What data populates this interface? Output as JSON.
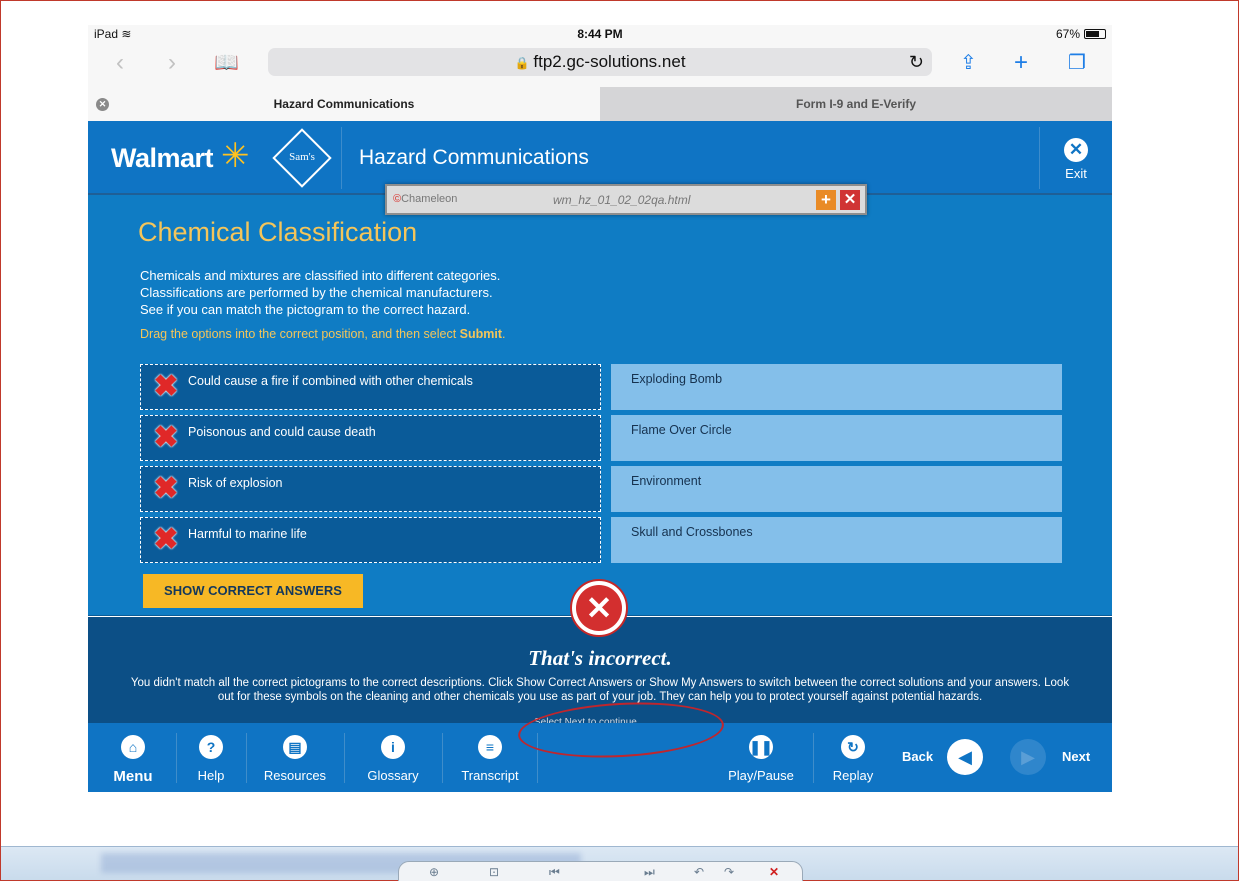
{
  "status_bar": {
    "device": "iPad",
    "time": "8:44 PM",
    "battery": "67%"
  },
  "browser": {
    "url": "ftp2.gc-solutions.net",
    "tabs": [
      {
        "label": "Hazard Communications",
        "active": true
      },
      {
        "label": "Form I-9 and E-Verify",
        "active": false
      }
    ]
  },
  "course_header": {
    "brand": "Walmart",
    "partner_logo": "Sam's CLUB",
    "title": "Hazard Communications",
    "exit_label": "Exit"
  },
  "overlay": {
    "logo": "Chameleon",
    "filename": "wm_hz_01_02_02qa.html"
  },
  "content": {
    "heading": "Chemical Classification",
    "intro_lines": [
      "Chemicals and mixtures are classified into different categories.",
      "Classifications are performed by the chemical manufacturers.",
      "See if you can match the pictogram to the correct hazard."
    ],
    "instruction_pre": "Drag the options into the correct position, and then select ",
    "instruction_bold": "Submit",
    "instruction_post": ".",
    "drag_items": [
      {
        "label": "Could cause a fire if combined with other chemicals",
        "status": "incorrect"
      },
      {
        "label": "Poisonous and could cause death",
        "status": "incorrect"
      },
      {
        "label": "Risk of explosion",
        "status": "incorrect"
      },
      {
        "label": "Harmful to marine life",
        "status": "incorrect"
      }
    ],
    "targets": [
      {
        "label": "Exploding Bomb"
      },
      {
        "label": "Flame Over Circle"
      },
      {
        "label": "Environment"
      },
      {
        "label": "Skull and Crossbones"
      }
    ],
    "show_answers_label": "SHOW CORRECT ANSWERS"
  },
  "feedback": {
    "title": "That's incorrect.",
    "text": "You didn't match all the correct pictograms to the correct descriptions. Click Show Correct Answers or Show My Answers to switch between the correct solutions and your answers. Look out for these symbols on the cleaning and other chemicals you use as part of your job. They can help you to protect yourself against potential hazards.",
    "hint": "Select Next to continue."
  },
  "nav": {
    "menu": "Menu",
    "help": "Help",
    "resources": "Resources",
    "glossary": "Glossary",
    "transcript": "Transcript",
    "play_pause": "Play/Pause",
    "replay": "Replay",
    "back": "Back",
    "next": "Next"
  },
  "colors": {
    "brand_blue": "#0f74c4",
    "heading_gold": "#f4c55a",
    "button_yellow": "#f7b825",
    "error_red": "#d32f2f"
  },
  "icons": {
    "wifi": "wifi-icon",
    "back": "chevron-left-icon",
    "forward": "chevron-right-icon",
    "bookmarks": "book-icon",
    "share": "share-icon",
    "add_tab": "plus-icon",
    "tabs": "tabs-icon",
    "reload": "reload-icon",
    "lock": "lock-icon",
    "exit": "close-circle-icon",
    "menu": "home-icon",
    "help": "question-icon",
    "resources": "document-icon",
    "glossary": "info-icon",
    "transcript": "list-icon",
    "play_pause": "pause-icon",
    "replay": "replay-icon"
  }
}
